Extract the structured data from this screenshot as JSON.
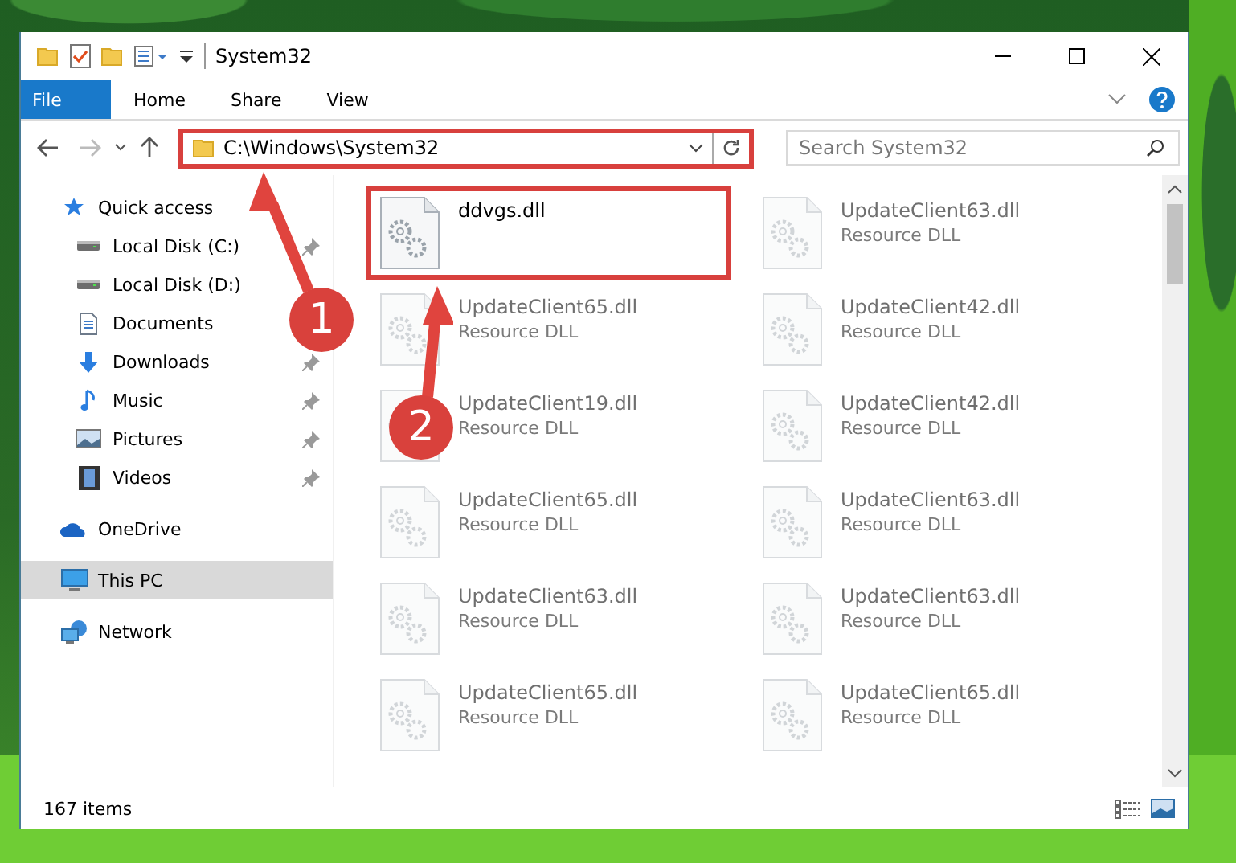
{
  "window": {
    "title": "System32"
  },
  "ribbon_tabs": [
    {
      "label": "File",
      "kind": "file"
    },
    {
      "label": "Home",
      "kind": "tab"
    },
    {
      "label": "Share",
      "kind": "tab"
    },
    {
      "label": "View",
      "kind": "tab"
    }
  ],
  "address": {
    "path": "C:\\Windows\\System32",
    "highlighted": true
  },
  "search": {
    "placeholder": "Search System32"
  },
  "sidebar": {
    "items": [
      {
        "label": "Quick access",
        "selected": false,
        "children": [
          {
            "label": "Local Disk (C:)",
            "pinned": true,
            "selected": false
          },
          {
            "label": "Local Disk (D:)",
            "selected": false
          },
          {
            "label": "Documents",
            "selected": false
          },
          {
            "label": "Downloads",
            "pinned": true,
            "selected": false
          },
          {
            "label": "Music",
            "pinned": true,
            "selected": false
          },
          {
            "label": "Pictures",
            "pinned": true,
            "selected": false
          },
          {
            "label": "Videos",
            "pinned": true,
            "selected": false
          }
        ]
      },
      {
        "label": "OneDrive",
        "selected": false
      },
      {
        "label": "This PC",
        "selected": true
      },
      {
        "label": "Network",
        "selected": false
      }
    ]
  },
  "files": [
    {
      "name": "ddvgs.dll",
      "blurred": false,
      "highlighted": true
    },
    {
      "name": "UpdateClient63.dll",
      "type": "Resource DLL",
      "blurred": true,
      "highlighted": false
    },
    {
      "name": "UpdateClient65.dll",
      "type": "Resource DLL",
      "blurred": true,
      "highlighted": false
    },
    {
      "name": "UpdateClient42.dll",
      "type": "Resource DLL",
      "blurred": true,
      "highlighted": false
    },
    {
      "name": "UpdateClient19.dll",
      "type": "Resource DLL",
      "blurred": true,
      "highlighted": false
    },
    {
      "name": "UpdateClient42.dll",
      "type": "Resource DLL",
      "blurred": true,
      "highlighted": false
    },
    {
      "name": "UpdateClient65.dll",
      "type": "Resource DLL",
      "blurred": true,
      "highlighted": false
    },
    {
      "name": "UpdateClient63.dll",
      "type": "Resource DLL",
      "blurred": true,
      "highlighted": false
    },
    {
      "name": "UpdateClient63.dll",
      "type": "Resource DLL",
      "blurred": true,
      "highlighted": false
    },
    {
      "name": "UpdateClient63.dll",
      "type": "Resource DLL",
      "blurred": true,
      "highlighted": false
    },
    {
      "name": "UpdateClient65.dll",
      "type": "Resource DLL",
      "blurred": true,
      "highlighted": false
    },
    {
      "name": "UpdateClient65.dll",
      "type": "Resource DLL",
      "blurred": true,
      "highlighted": false
    }
  ],
  "status_bar": {
    "text": "167 items"
  },
  "annotations": [
    {
      "label": "1"
    },
    {
      "label": "2"
    }
  ]
}
